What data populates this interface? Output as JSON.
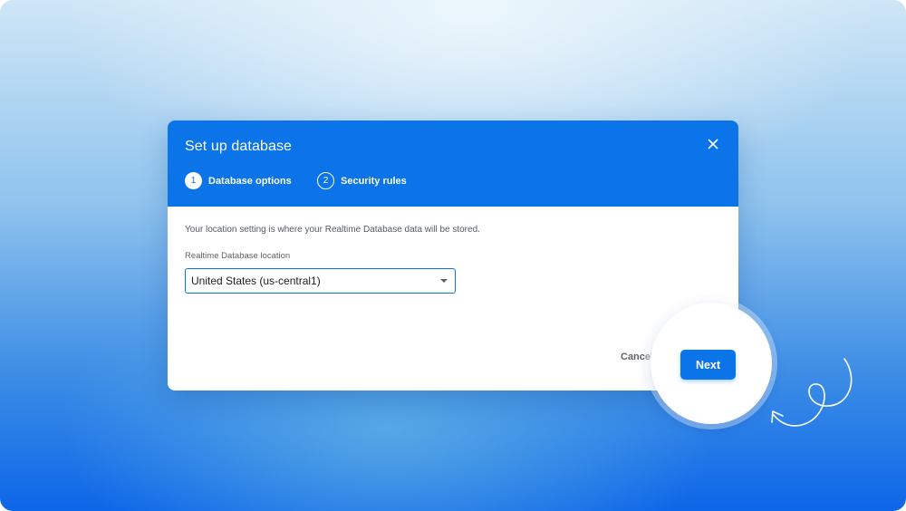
{
  "dialog": {
    "title": "Set up database",
    "close_icon": "close-icon",
    "steps": [
      {
        "number": "1",
        "label": "Database options",
        "active": true
      },
      {
        "number": "2",
        "label": "Security rules",
        "active": false
      }
    ],
    "description": "Your location setting is where your Realtime Database data will be stored.",
    "location_label": "Realtime Database location",
    "location_value": "United States (us-central1)",
    "cancel_label": "Cancel",
    "next_label": "Next"
  },
  "colors": {
    "accent": "#0a74e8",
    "header_text": "#ffffff",
    "body_text": "#555b63"
  }
}
